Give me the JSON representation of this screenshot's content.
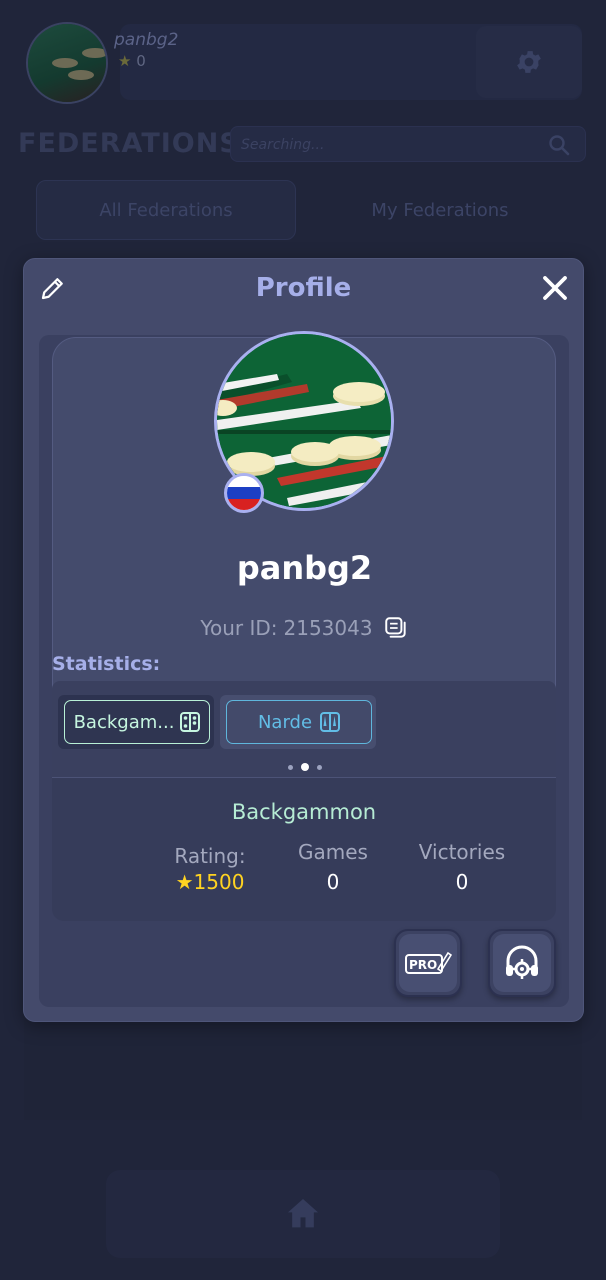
{
  "background": {
    "username": "panbg2",
    "stars": "0",
    "section_title": "FEDERATIONS",
    "search_placeholder": "Searching...",
    "tabs": [
      {
        "label": "All Federations"
      },
      {
        "label": "My Federations"
      }
    ],
    "icons": {
      "settings": "gear-icon",
      "search": "search-icon",
      "home": "home-icon"
    }
  },
  "modal": {
    "title": "Profile",
    "username": "panbg2",
    "id_label": "Your ID:",
    "id_value": "2153043",
    "country_flag": "russia-flag",
    "statistics_label": "Statistics:",
    "game_tabs": [
      {
        "label": "Backgam...",
        "active": true,
        "icon": "backgammon-board-icon"
      },
      {
        "label": "Narde",
        "active": false,
        "icon": "narde-board-icon"
      }
    ],
    "pagination": {
      "count": 3,
      "active_index": 1
    },
    "selected_game": "Backgammon",
    "stats": {
      "rating_label": "Rating:",
      "rating_value": "1500",
      "games_label": "Games",
      "games_value": "0",
      "victories_label": "Victories",
      "victories_value": "0"
    },
    "buttons": {
      "pro": "PRO",
      "support": "support-icon"
    },
    "colors": {
      "accent": "#a6afe9",
      "active_tab": "#b8f0d6",
      "inactive_tab": "#5fb6dc",
      "rating": "#ffd321"
    }
  }
}
